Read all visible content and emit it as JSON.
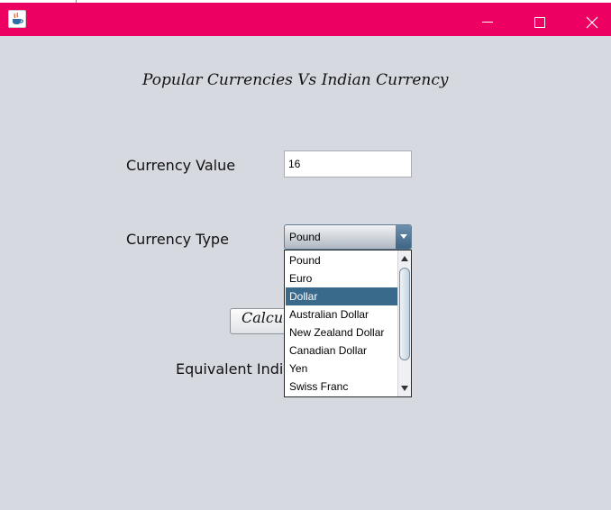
{
  "window": {
    "icon": "java-cup-icon",
    "controls": [
      "minimize-icon",
      "maximize-icon",
      "close-icon"
    ],
    "titlebar_color": "#ec0062"
  },
  "heading": "Popular Currencies Vs Indian Currency",
  "form": {
    "currency_value_label": "Currency Value",
    "currency_value": "16",
    "currency_type_label": "Currency Type",
    "currency_type_selected": "Pound",
    "calculate_button_visible_text": "Calcul",
    "result_label_visible_text": "Equivalent Indi"
  },
  "dropdown": {
    "options": [
      "Pound",
      "Euro",
      "Dollar",
      "Australian Dollar",
      "New Zealand Dollar",
      "Canadian Dollar",
      "Yen",
      "Swiss Franc"
    ],
    "highlighted": "Dollar",
    "highlight_color": "#39698b"
  }
}
